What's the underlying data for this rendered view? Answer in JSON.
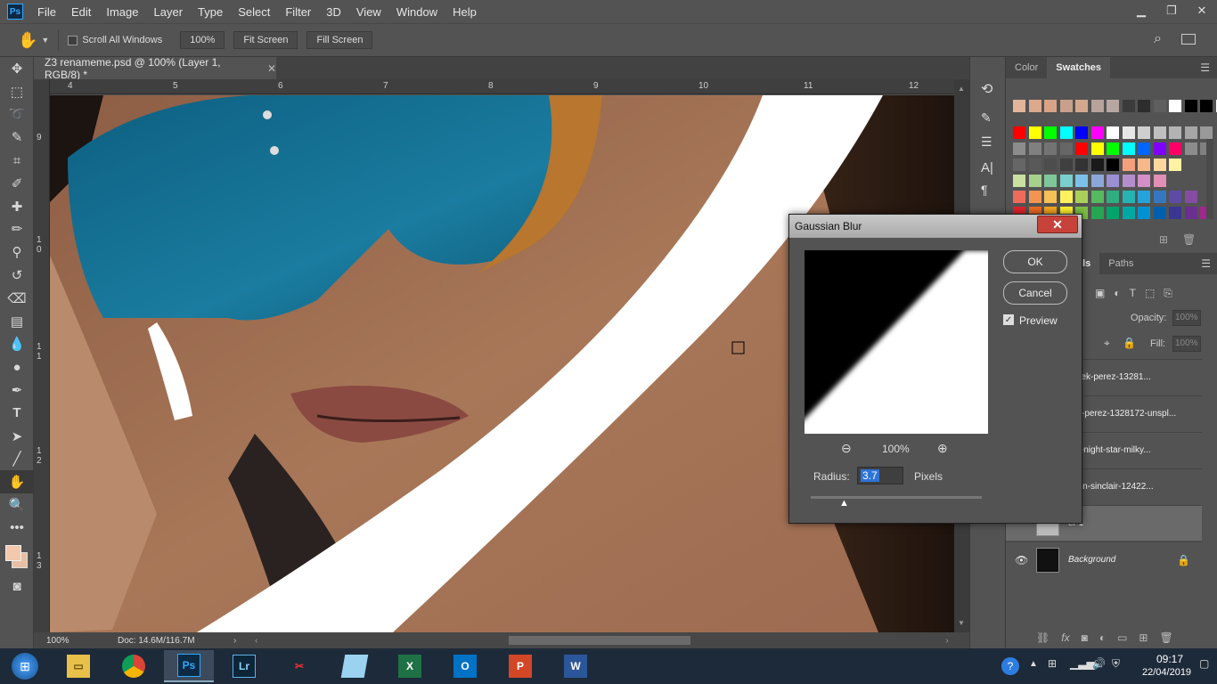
{
  "app": {
    "logo": "Ps"
  },
  "menu": [
    "File",
    "Edit",
    "Image",
    "Layer",
    "Type",
    "Select",
    "Filter",
    "3D",
    "View",
    "Window",
    "Help"
  ],
  "window_controls": [
    "minimize",
    "restore",
    "close"
  ],
  "options": {
    "scroll_all": "Scroll All Windows",
    "zoom": "100%",
    "fit": "Fit Screen",
    "fill": "Fill Screen"
  },
  "document": {
    "tab_title": "Z3 renameme.psd @ 100% (Layer 1, RGB/8) *",
    "ruler_top": [
      "4",
      "5",
      "6",
      "7",
      "8",
      "9",
      "10",
      "11",
      "12"
    ],
    "ruler_left": [
      "9",
      "1 0",
      "1 1",
      "1 2",
      "1 3"
    ],
    "zoom": "100%",
    "doc_info": "Doc: 14.6M/116.7M"
  },
  "panels": {
    "color_tab": "Color",
    "swatches_tab": "Swatches",
    "layers_tab_partial": "els",
    "paths_tab": "Paths",
    "opacity_label": "Opacity:",
    "opacity_value": "100%",
    "fill_label": "Fill:",
    "fill_value": "100%",
    "layers": [
      {
        "name": "derek-perez-13281...",
        "thumb": "#222"
      },
      {
        "name": "k-perez-1328172-unspl...",
        "thumb": "#333"
      },
      {
        "name": "fog-night-star-milky...",
        "thumb": "#111"
      },
      {
        "name": "sean-sinclair-12422...",
        "thumb": "#ddd"
      },
      {
        "name": "er 1",
        "thumb": "#bbb"
      },
      {
        "name": "Background",
        "thumb": "#111"
      }
    ]
  },
  "swatch_colors": {
    "row0": [
      "#e3b59a",
      "#dba98c",
      "#d8a387",
      "#c9a08c",
      "#d3a88e",
      "#b7a39a",
      "#b6a8a0",
      "#3b3b3b",
      "#2d2d2d",
      "#5e5e5e",
      "#ffffff",
      "#000000",
      "#000000",
      "#ffffff"
    ],
    "row1": [
      "#ff0000",
      "#ffff00",
      "#00ff00",
      "#00ffff",
      "#0000ff",
      "#ff00ff",
      "#ffffff",
      "#e6e6e6",
      "#cfcfcf",
      "#bfbfbf",
      "#b3b3b3",
      "#a6a6a6",
      "#999999"
    ],
    "row2": [
      "#8c8c8c",
      "#808080",
      "#737373",
      "#666666",
      "#ff0000",
      "#ffff00",
      "#00ff00",
      "#00ffff",
      "#0066ff",
      "#8000ff",
      "#ff0066",
      "#8c8c8c",
      "#808080"
    ],
    "row3": [
      "#666666",
      "#595959",
      "#4d4d4d",
      "#404040",
      "#333333",
      "#1a1a1a",
      "#000000",
      "#f3a07a",
      "#f7b98a",
      "#fdd79d",
      "#fff2a3"
    ],
    "row4": [
      "#c9e0a0",
      "#a7d08c",
      "#7ec699",
      "#79cfcb",
      "#7cc2e8",
      "#8ba7d8",
      "#9b8fd1",
      "#b48ecc",
      "#d48ec7",
      "#e38fb5"
    ],
    "row5": [
      "#ee6b5b",
      "#f39552",
      "#f6c155",
      "#fff15e",
      "#a9d15a",
      "#55b95e",
      "#2fae80",
      "#26b4b3",
      "#24a3dc",
      "#3479c0",
      "#5d4ba5",
      "#864ca3"
    ],
    "row6": [
      "#e0242d",
      "#ef6a25",
      "#f6a420",
      "#fff22d",
      "#7cc242",
      "#26a651",
      "#00a56b",
      "#00a8a4",
      "#0091d3",
      "#0060ad",
      "#3a3694",
      "#6a2f90",
      "#a3268f"
    ]
  },
  "dialog": {
    "title": "Gaussian Blur",
    "close": "✕",
    "ok": "OK",
    "cancel": "Cancel",
    "preview_label": "Preview",
    "preview_checked": true,
    "zoom": "100%",
    "radius_label": "Radius:",
    "radius_value": "3.7",
    "units": "Pixels"
  },
  "taskbar": {
    "time": "09:17",
    "date": "22/04/2019",
    "apps": [
      {
        "name": "file-explorer",
        "label": ""
      },
      {
        "name": "chrome",
        "label": ""
      },
      {
        "name": "photoshop",
        "label": "Ps"
      },
      {
        "name": "lightroom",
        "label": "Lr"
      },
      {
        "name": "snipping-tool",
        "label": ""
      },
      {
        "name": "notes",
        "label": ""
      },
      {
        "name": "excel",
        "label": "X"
      },
      {
        "name": "outlook",
        "label": "O"
      },
      {
        "name": "powerpoint",
        "label": "P"
      },
      {
        "name": "word",
        "label": "W"
      }
    ]
  }
}
